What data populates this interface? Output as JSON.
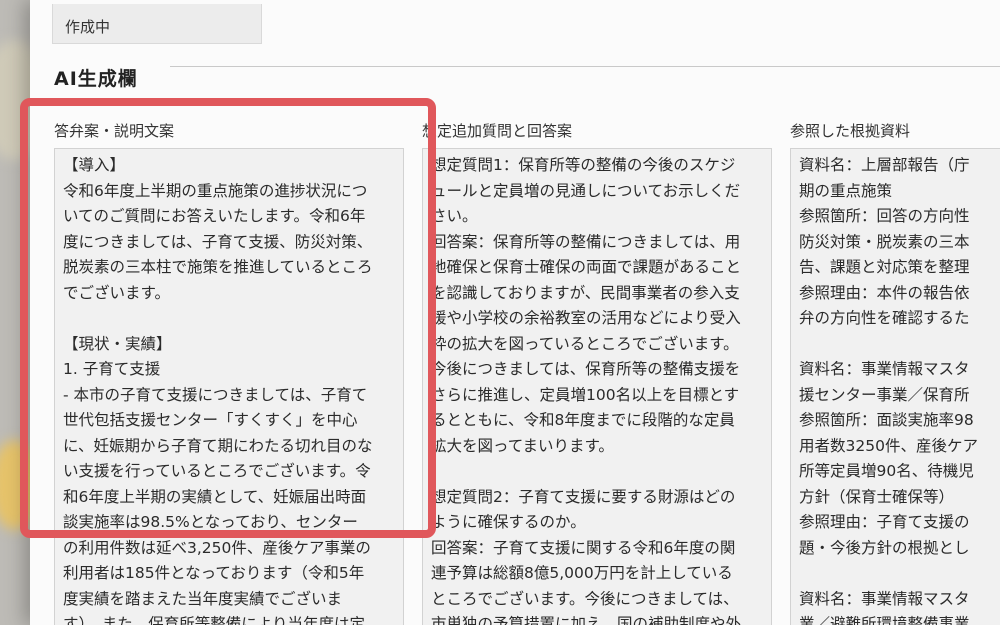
{
  "status": {
    "value": "作成中"
  },
  "section": {
    "title": "AI生成欄"
  },
  "columns": [
    {
      "label": "答弁案・説明文案",
      "lines": [
        "【導入】",
        "令和6年度上半期の重点施策の進捗状況につ",
        "いてのご質問にお答えいたします。令和6年",
        "度につきましては、子育て支援、防災対策、",
        "脱炭素の三本柱で施策を推進しているところ",
        "でございます。",
        "",
        "【現状・実績】",
        "1. 子育て支援",
        "- 本市の子育て支援につきましては、子育て",
        "世代包括支援センター「すくすく」を中心",
        "に、妊娠期から子育て期にわたる切れ目のな",
        "い支援を行っているところでございます。令",
        "和6年度上半期の実績として、妊娠届出時面",
        "談実施率は98.5%となっており、センター",
        "の利用件数は延べ3,250件、産後ケア事業の",
        "利用者は185件となっております（令和5年",
        "度実績を踏まえた当年度実績でございま",
        "す）。また、保育所等整備により当年度は定"
      ]
    },
    {
      "label": "想定追加質問と回答案",
      "lines": [
        "想定質問1：保育所等の整備の今後のスケジ",
        "ュールと定員増の見通しについてお示しくだ",
        "さい。",
        "回答案：保育所等の整備につきましては、用",
        "地確保と保育士確保の両面で課題があること",
        "を認識しておりますが、民間事業者の参入支",
        "援や小学校の余裕教室の活用などにより受入",
        "枠の拡大を図っているところでございます。",
        "今後につきましては、保育所等の整備支援を",
        "さらに推進し、定員増100名以上を目標とす",
        "るとともに、令和8年度までに段階的な定員",
        "拡大を図ってまいります。",
        "",
        "想定質問2：子育て支援に要する財源はどの",
        "ように確保するのか。",
        "回答案：子育て支援に関する令和6年度の関",
        "連予算は総額8億5,000万円を計上している",
        "ところでございます。今後につきましては、",
        "市単独の予算措置に加え、国の補助制度や外"
      ]
    },
    {
      "label": "参照した根拠資料",
      "lines": [
        "資料名：上層部報告（庁",
        "期の重点施策",
        "参照箇所：回答の方向性",
        "防災対策・脱炭素の三本",
        "告、課題と対応策を整理",
        "参照理由：本件の報告依",
        "弁の方向性を確認するた",
        "",
        "資料名：事業情報マスタ",
        "援センター事業／保育所",
        "参照箇所：面談実施率98",
        "用者数3250件、産後ケア",
        "所等定員増90名、待機児",
        "方針（保育士確保等）",
        "参照理由：子育て支援の",
        "題・今後方針の根拠とし",
        "",
        "資料名：事業情報マスタ",
        "業／避難所環境整備事業"
      ]
    }
  ]
}
